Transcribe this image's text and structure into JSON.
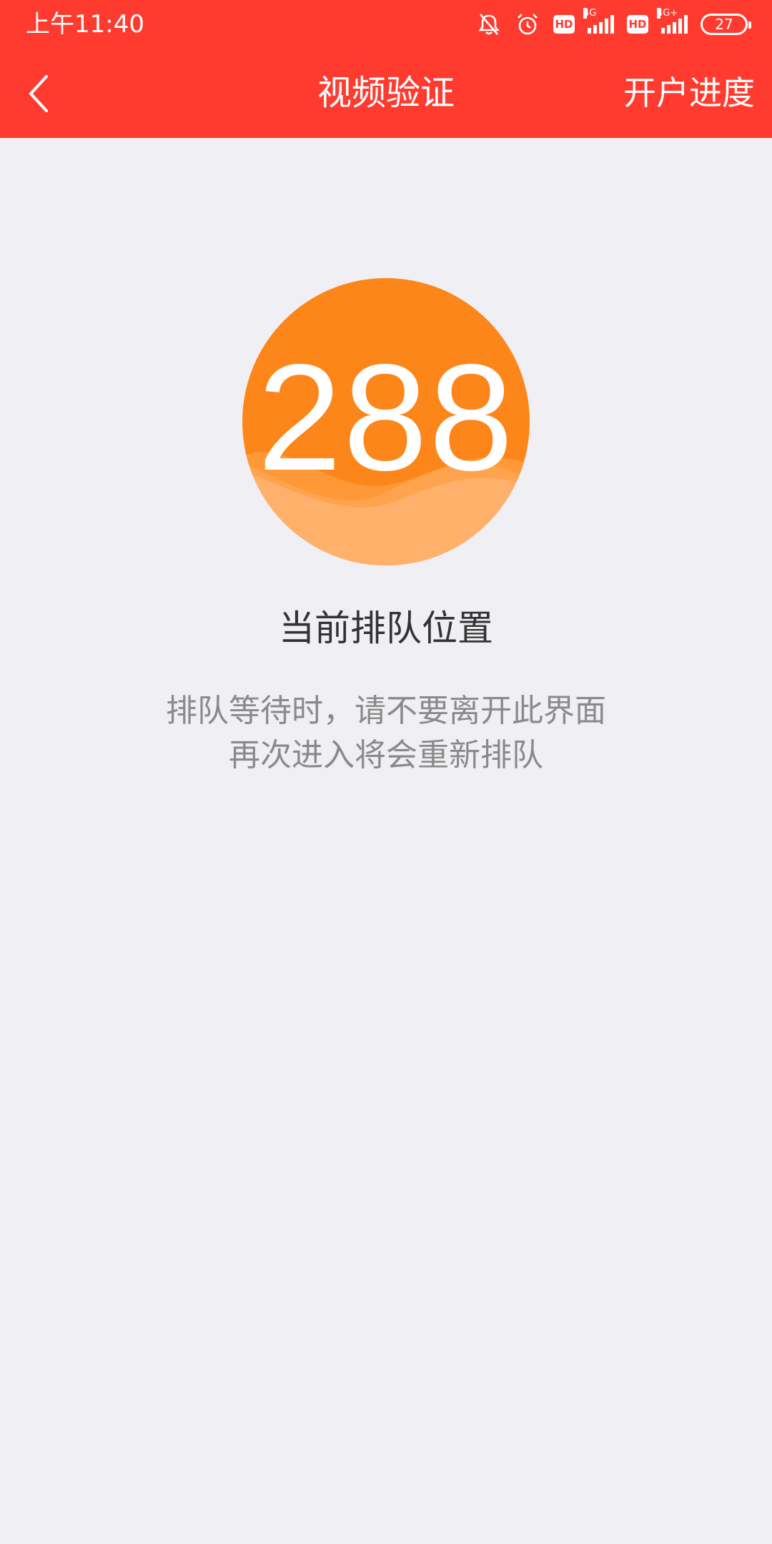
{
  "status_bar": {
    "time": "上午11:40",
    "hd_1": "HD",
    "net_1": "4G",
    "hd_2": "HD",
    "net_2": "4G+",
    "battery": "27"
  },
  "navbar": {
    "title": "视频验证",
    "action_label": "开户进度",
    "back_icon": "chevron-left-icon"
  },
  "queue": {
    "position": "288",
    "label": "当前排队位置",
    "hint_line_1": "排队等待时，请不要离开此界面",
    "hint_line_2": "再次进入将会重新排队"
  },
  "colors": {
    "header": "#ff3b30",
    "circle_top": "#fd861a",
    "circle_wave": "#ffb06a",
    "background": "#f0f0f4"
  }
}
